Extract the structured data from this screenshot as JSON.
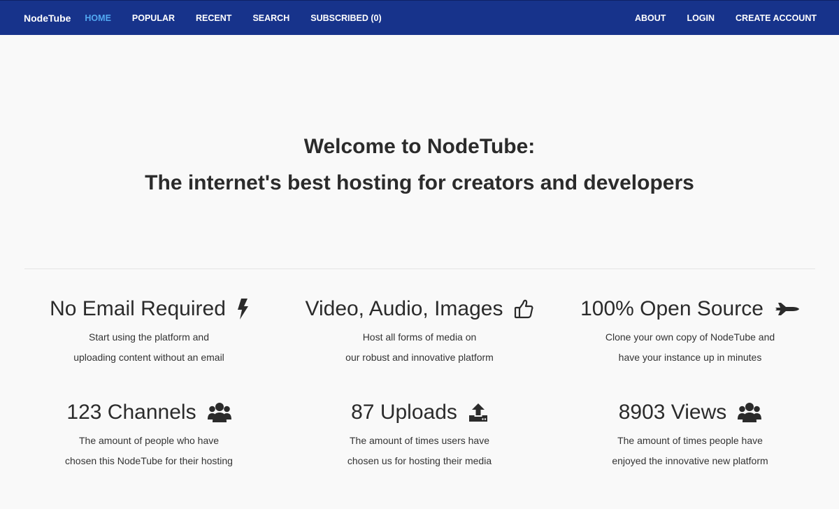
{
  "nav": {
    "brand": "NodeTube",
    "left_links": [
      "HOME",
      "POPULAR",
      "RECENT",
      "SEARCH",
      "SUBSCRIBED (0)"
    ],
    "right_links": [
      "ABOUT",
      "LOGIN",
      "CREATE ACCOUNT"
    ],
    "active_link": "HOME",
    "active_color": "#52a8f2",
    "background_color": "#17338b"
  },
  "hero": {
    "line1": "Welcome to NodeTube:",
    "line2": "The internet's best hosting for creators and developers"
  },
  "features": [
    {
      "title": "No Email Required",
      "icon": "lightning-bolt-icon",
      "desc1": "Start using the platform and",
      "desc2": "uploading content without an email"
    },
    {
      "title": "Video, Audio, Images",
      "icon": "thumbs-up-icon",
      "desc1": "Host all forms of media on",
      "desc2": "our robust and innovative platform"
    },
    {
      "title": "100% Open Source",
      "icon": "fighter-jet-icon",
      "desc1": "Clone your own copy of NodeTube and",
      "desc2": "have your instance up in minutes"
    }
  ],
  "stats": [
    {
      "title": "123 Channels",
      "icon": "users-icon",
      "desc1": "The amount of people who have",
      "desc2": "chosen this NodeTube for their hosting"
    },
    {
      "title": "87 Uploads",
      "icon": "upload-icon",
      "desc1": "The amount of times users have",
      "desc2": "chosen us for hosting their media"
    },
    {
      "title": "8903 Views",
      "icon": "users-icon",
      "desc1": "The amount of times people have",
      "desc2": "enjoyed the innovative new platform"
    }
  ]
}
